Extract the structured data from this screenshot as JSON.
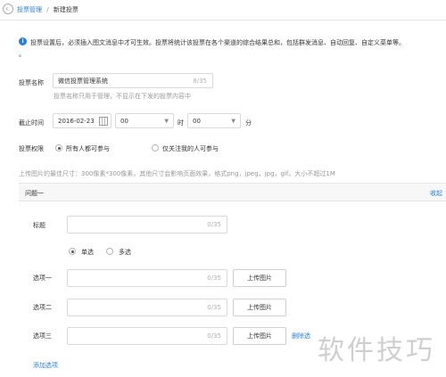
{
  "breadcrumb": {
    "back": "投票管理",
    "sep": "/",
    "current": "新建投票"
  },
  "notice": {
    "icon": "info-icon",
    "text": "投票设置后，必须插入图文消息中才可生效。投票将统计该投票在各个渠道的综合结果总和，包括群发消息、自动回复、自定义菜单等。",
    "continuation": "。"
  },
  "form": {
    "name_label": "投票名称",
    "name_value": "微信投票管理系统",
    "name_counter": "8/35",
    "name_hint": "投票名称只用于管理，不显示在下发的投票内容中",
    "deadline_label": "截止时间",
    "date": "2016-02-23",
    "hour": "00",
    "hour_unit": "时",
    "minute": "00",
    "minute_unit": "分",
    "perm_label": "投票权限",
    "perm_all": "所有人都可参与",
    "perm_followers": "仅关注我的人可参与",
    "upload_note": "上传图片的最佳尺寸：300像素*300像素，其他尺寸会影响页面效果，格式png，jpeg，jpg，gif。大小不超过1M"
  },
  "question": {
    "header": "问题一",
    "collapse": "收起",
    "title_label": "标题",
    "title_counter": "0/35",
    "single": "单选",
    "multi": "多选",
    "options": [
      {
        "label": "选项一",
        "counter": "0/35",
        "upload": "上传图片"
      },
      {
        "label": "选项二",
        "counter": "0/35",
        "upload": "上传图片"
      },
      {
        "label": "选项三",
        "counter": "0/35",
        "upload": "上传图片",
        "delete": "删除选"
      }
    ],
    "add_option": "添加选项"
  },
  "watermark": "软件技巧",
  "colors": {
    "link": "#2a7fd4",
    "info": "#2a7fd4",
    "panel": "#f7f7f7",
    "border": "#d9d9d9"
  }
}
